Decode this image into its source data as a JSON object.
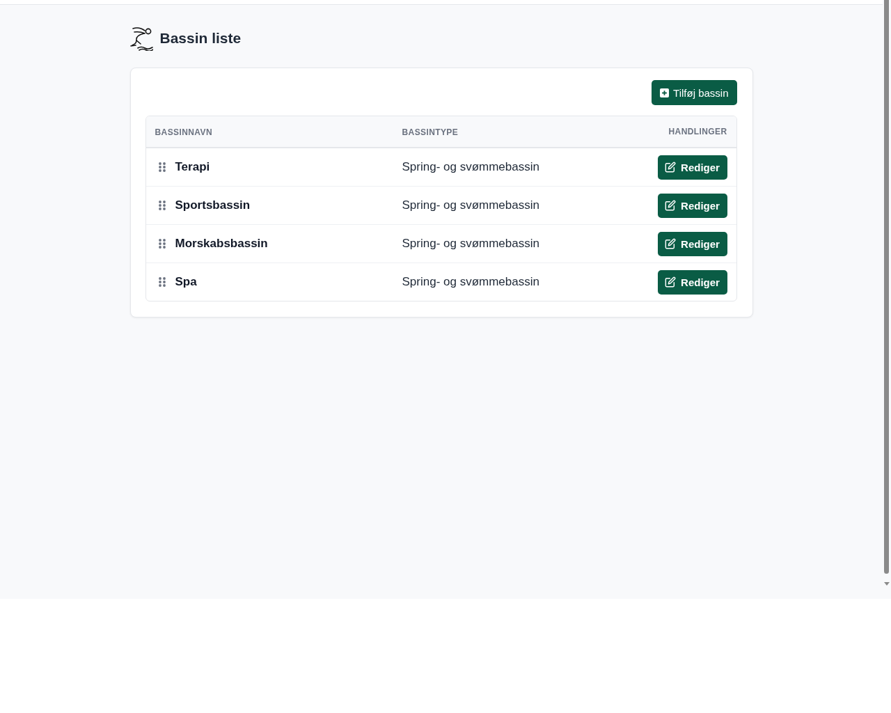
{
  "header": {
    "title": "Bassin liste"
  },
  "card": {
    "add_button": {
      "label": "Tilføj bassin"
    },
    "table": {
      "columns": [
        "BASSINNAVN",
        "BASSINTYPE",
        "HANDLINGER"
      ],
      "rows": [
        {
          "name": "Terapi",
          "type": "Spring- og svømmebassin",
          "action": "Rediger"
        },
        {
          "name": "Sportsbassin",
          "type": "Spring- og svømmebassin",
          "action": "Rediger"
        },
        {
          "name": "Morskabsbassin",
          "type": "Spring- og svømmebassin",
          "action": "Rediger"
        },
        {
          "name": "Spa",
          "type": "Spring- og svømmebassin",
          "action": "Rediger"
        }
      ]
    }
  }
}
